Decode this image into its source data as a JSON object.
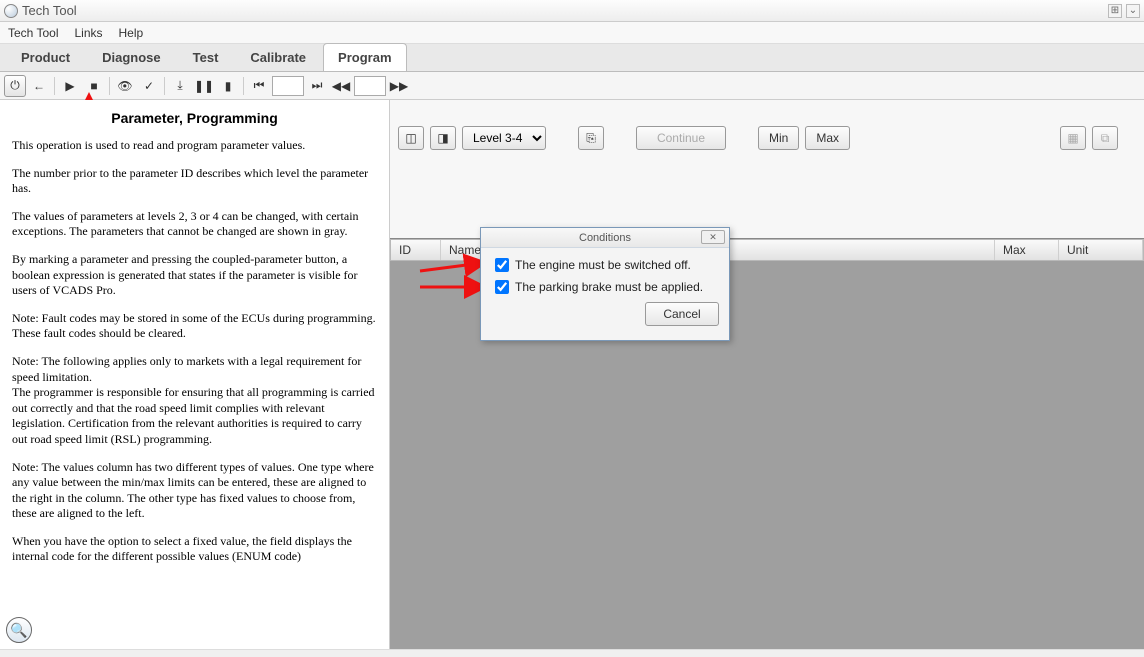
{
  "window": {
    "title": "Tech Tool"
  },
  "menu": {
    "items": [
      "Tech Tool",
      "Links",
      "Help"
    ]
  },
  "tabs": {
    "items": [
      "Product",
      "Diagnose",
      "Test",
      "Calibrate",
      "Program"
    ],
    "active": 4
  },
  "toolbar_icons": {
    "power": "⏻",
    "back": "←",
    "play": "▶",
    "stop": "■",
    "eye": "👁",
    "check": "✓",
    "step_in": "⤓",
    "pause": "❚❚",
    "record": "▮",
    "prev": "⏮",
    "next": "⏭",
    "rewind": "◀◀",
    "fforward": "▶▶"
  },
  "left": {
    "heading": "Parameter, Programming",
    "p1": "This operation is used to read and program parameter values.",
    "p2": "The number prior to the parameter ID describes which level the parameter has.",
    "p3": "The values of parameters at levels 2, 3 or 4 can be changed, with certain exceptions. The parameters that cannot be changed are shown in gray.",
    "p4": "By marking a parameter and pressing the coupled-parameter button, a boolean expression is generated that states if the parameter is visible for users of VCADS Pro.",
    "p5": "Note: Fault codes may be stored in some of the ECUs during programming. These fault codes should be cleared.",
    "p6": "Note: The following applies only to markets with a legal requirement for speed limitation.\nThe programmer is responsible for ensuring that all programming is carried out correctly and that the road speed limit complies with relevant legislation. Certification from the relevant authorities is required to carry out road speed limit (RSL) programming.",
    "p7": "Note: The values column has two different types of values. One type where any value between the min/max limits can be entered, these are aligned to the right in the column. The other type has fixed values to choose from, these are aligned to the left.",
    "p8": "When you have the option to select a fixed value, the field displays the internal code for the different possible values (ENUM code)"
  },
  "right": {
    "level_label": "Level 3-4",
    "continue": "Continue",
    "min": "Min",
    "max": "Max",
    "icon_grid": "▦",
    "icon_link": "⧉"
  },
  "table": {
    "id": "ID",
    "name": "Name",
    "max": "Max",
    "unit": "Unit"
  },
  "dialog": {
    "title": "Conditions",
    "cond1": "The engine must be switched off.",
    "cond2": "The parking brake must be applied.",
    "cancel": "Cancel"
  }
}
